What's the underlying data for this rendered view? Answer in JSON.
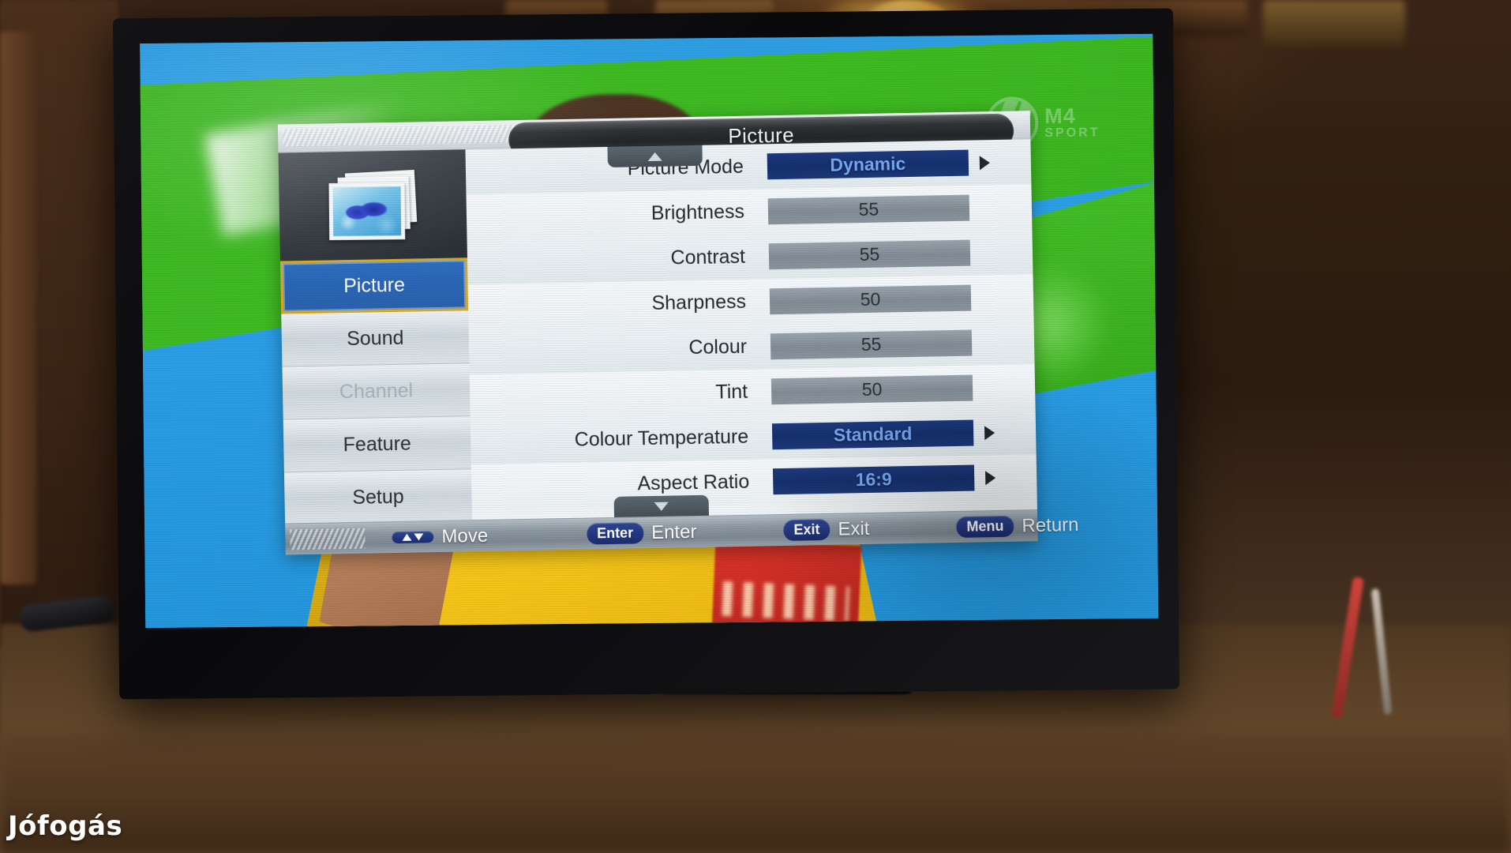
{
  "brand_watermark": "Jófogás",
  "channel_logo": {
    "name": "M4",
    "subtitle": "SPORT"
  },
  "osd": {
    "title": "Picture",
    "icon_name": "picture-photos-icon",
    "sidebar": [
      {
        "label": "Picture",
        "state": "selected"
      },
      {
        "label": "Sound",
        "state": "normal"
      },
      {
        "label": "Channel",
        "state": "disabled"
      },
      {
        "label": "Feature",
        "state": "normal"
      },
      {
        "label": "Setup",
        "state": "normal"
      }
    ],
    "options": [
      {
        "label": "Picture Mode",
        "value": "Dynamic",
        "highlight": true,
        "arrow": true
      },
      {
        "label": "Brightness",
        "value": "55",
        "highlight": false,
        "arrow": false
      },
      {
        "label": "Contrast",
        "value": "55",
        "highlight": false,
        "arrow": false
      },
      {
        "label": "Sharpness",
        "value": "50",
        "highlight": false,
        "arrow": false
      },
      {
        "label": "Colour",
        "value": "55",
        "highlight": false,
        "arrow": false
      },
      {
        "label": "Tint",
        "value": "50",
        "highlight": false,
        "arrow": false
      },
      {
        "label": "Colour Temperature",
        "value": "Standard",
        "highlight": true,
        "arrow": true
      },
      {
        "label": "Aspect Ratio",
        "value": "16:9",
        "highlight": true,
        "arrow": true
      }
    ],
    "scroll": {
      "up": "scroll-up-arrow",
      "down": "scroll-down-arrow"
    },
    "help_bar": [
      {
        "key": "▲▼",
        "action": "Move"
      },
      {
        "key": "Enter",
        "action": "Enter"
      },
      {
        "key": "Exit",
        "action": "Exit"
      },
      {
        "key": "Menu",
        "action": "Return"
      }
    ]
  },
  "colors": {
    "selected_blue": "#2a66b6",
    "selected_border_gold": "#d6ab2a",
    "value_highlight_navy": "#16306e",
    "value_highlight_text": "#74a9f5",
    "value_grey": "#818c96",
    "help_key_navy": "#1b2c6e"
  }
}
